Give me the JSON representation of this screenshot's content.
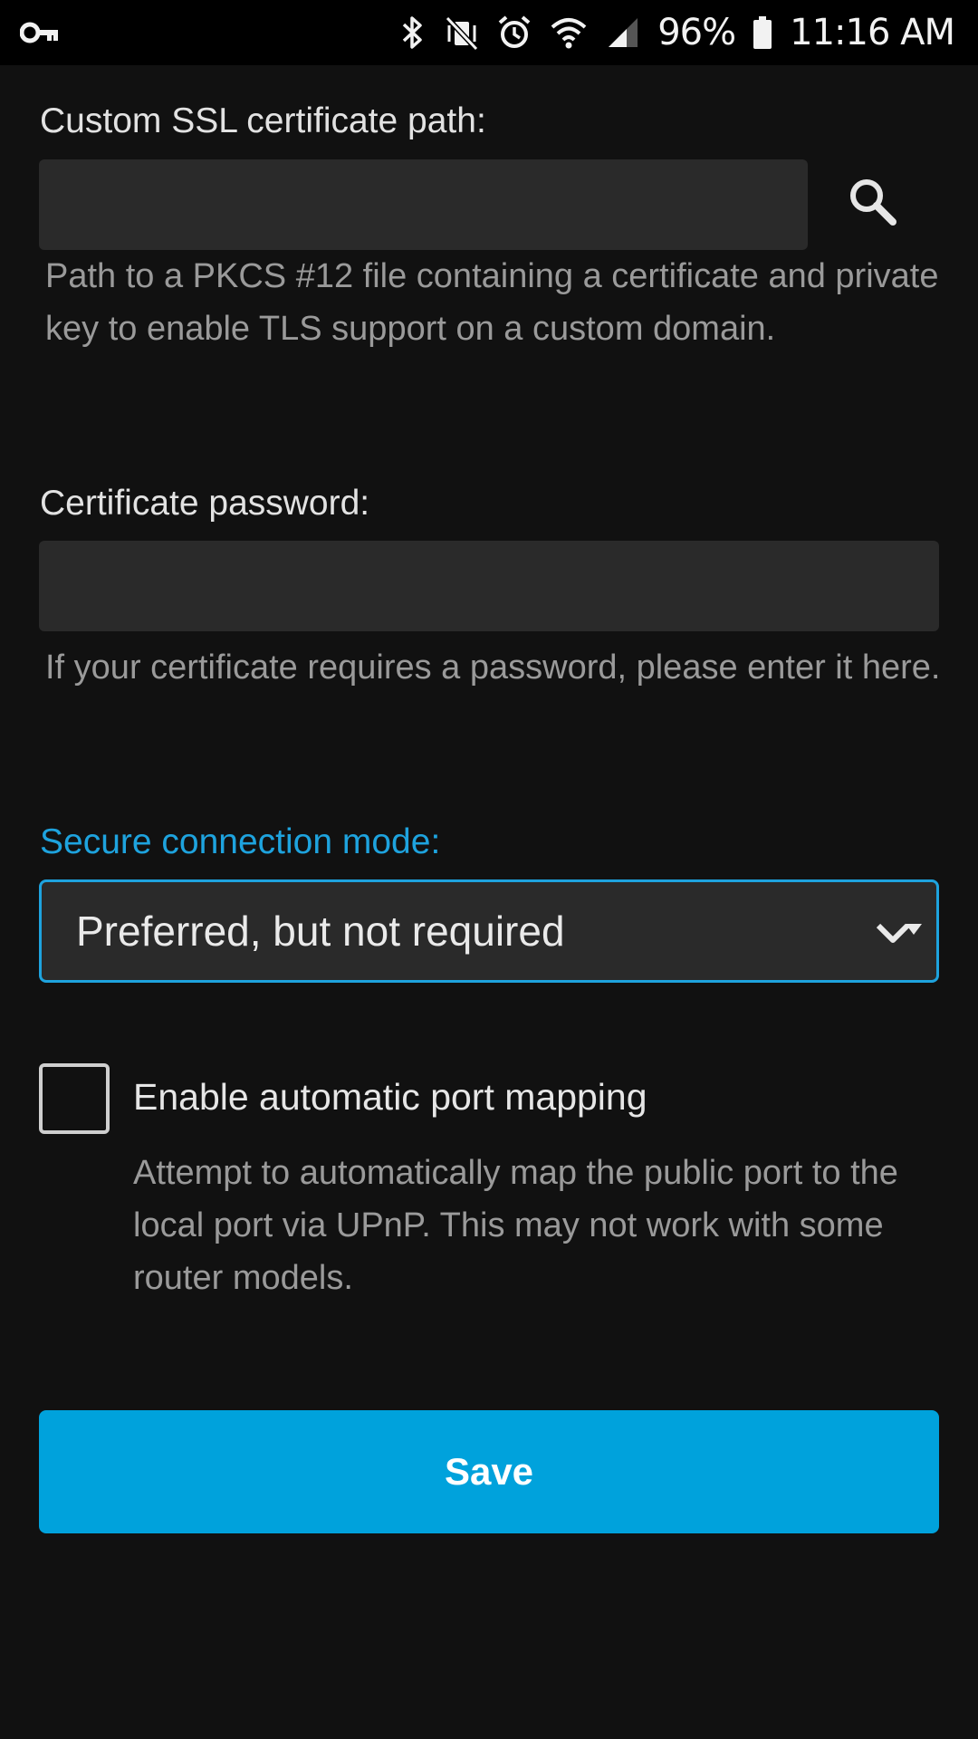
{
  "status_bar": {
    "battery_percent": "96%",
    "time": "11:16 AM",
    "icons": [
      "key-icon",
      "bluetooth-icon",
      "vibrate-mute-icon",
      "alarm-icon",
      "wifi-icon",
      "cell-signal-icon",
      "battery-icon"
    ]
  },
  "ssl_path": {
    "label": "Custom SSL certificate path:",
    "value": "",
    "help": "Path to a PKCS #12 file containing a certificate and private key to enable TLS support on a custom domain.",
    "browse_icon": "search-icon"
  },
  "cert_password": {
    "label": "Certificate password:",
    "value": "",
    "help": "If your certificate requires a password, please enter it here."
  },
  "connection_mode": {
    "label": "Secure connection mode:",
    "selected": "Preferred, but not required",
    "arrow_icon": "chevron-down-icon"
  },
  "port_mapping": {
    "label": "Enable automatic port mapping",
    "checked": false,
    "help": "Attempt to automatically map the public port to the local port via UPnP. This may not work with some router models."
  },
  "save_label": "Save",
  "colors": {
    "background": "#111111",
    "field": "#2a2a2a",
    "accent": "#1ea3de",
    "button": "#00a2dc",
    "help_text": "#9a9a9a"
  }
}
